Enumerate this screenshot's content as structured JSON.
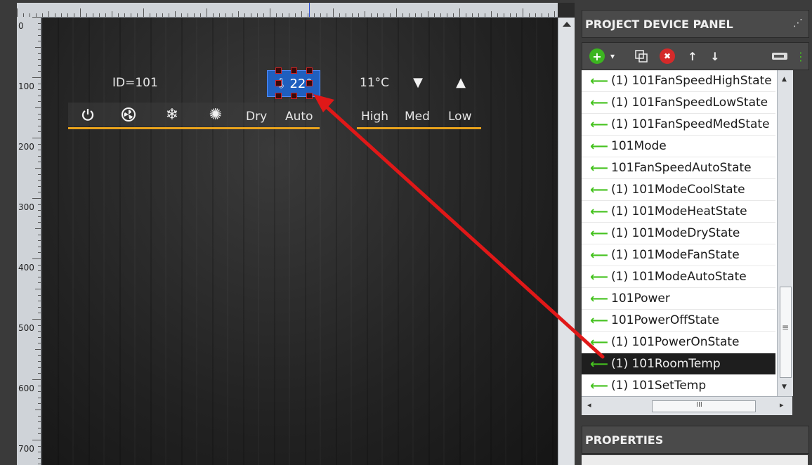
{
  "canvas": {
    "ruler_left_labels": [
      "0",
      "100",
      "200",
      "300",
      "400",
      "500",
      "600",
      "700"
    ],
    "device_id_label": "ID=101",
    "temp_widget_value": "22°",
    "outside_temp": "11°C",
    "mode_buttons": {
      "power_icon": "power-icon",
      "fan_icon": "fan-icon",
      "cool_icon": "snowflake-icon",
      "heat_icon": "sun-icon",
      "dry": "Dry",
      "auto": "Auto"
    },
    "fan_speed_buttons": [
      "High",
      "Med",
      "Low"
    ],
    "colors": {
      "accent_underline": "#e8a21c",
      "selected_widget": "#1f5fbf",
      "annotation_arrow": "#e01818"
    }
  },
  "panel": {
    "title": "PROJECT DEVICE PANEL",
    "toolbar": {
      "add": "+",
      "dropdown": "▾",
      "copy_icon": "copy-icon",
      "delete": "✖",
      "up": "↑",
      "down": "↓"
    },
    "items": [
      {
        "label": "(1) 101FanSpeedHighState",
        "selected": false
      },
      {
        "label": "(1) 101FanSpeedLowState",
        "selected": false
      },
      {
        "label": "(1) 101FanSpeedMedState",
        "selected": false
      },
      {
        "label": "101Mode",
        "selected": false
      },
      {
        "label": "101FanSpeedAutoState",
        "selected": false
      },
      {
        "label": "(1) 101ModeCoolState",
        "selected": false
      },
      {
        "label": "(1) 101ModeHeatState",
        "selected": false
      },
      {
        "label": "(1) 101ModeDryState",
        "selected": false
      },
      {
        "label": "(1) 101ModeFanState",
        "selected": false
      },
      {
        "label": "(1) 101ModeAutoState",
        "selected": false
      },
      {
        "label": "101Power",
        "selected": false
      },
      {
        "label": "101PowerOffState",
        "selected": false
      },
      {
        "label": "(1) 101PowerOnState",
        "selected": false
      },
      {
        "label": "(1) 101RoomTemp",
        "selected": true
      },
      {
        "label": "(1) 101SetTemp",
        "selected": false
      }
    ],
    "scrollbar_grip": "≡",
    "hscroll_grip": "III",
    "properties_title": "PROPERTIES"
  }
}
